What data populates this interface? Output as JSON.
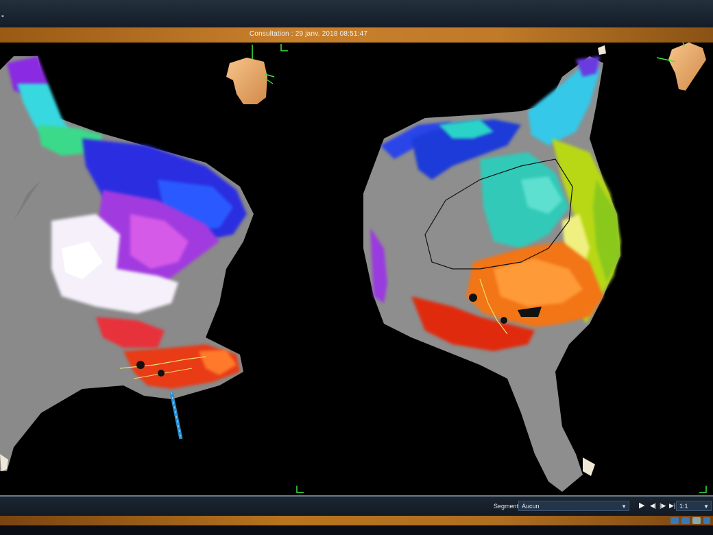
{
  "window": {
    "consultation_text": "Consultation : 29 janv. 2018 08:51:47"
  },
  "viewer": {
    "views": [
      {
        "name": "left-view"
      },
      {
        "name": "right-view"
      }
    ]
  },
  "toolbar": {
    "segment_label": "Segment",
    "segment_value": "Aucun",
    "zoom_value": "1:1",
    "play_icon": "play-icon",
    "step_back_icon": "step-back-icon",
    "step_forward_icon": "step-forward-icon",
    "end_icon": "skip-end-icon"
  },
  "colors": {
    "accent_orange": "#c8802c",
    "toolbar_bg": "#1a2430",
    "select_bg": "#24354a"
  }
}
